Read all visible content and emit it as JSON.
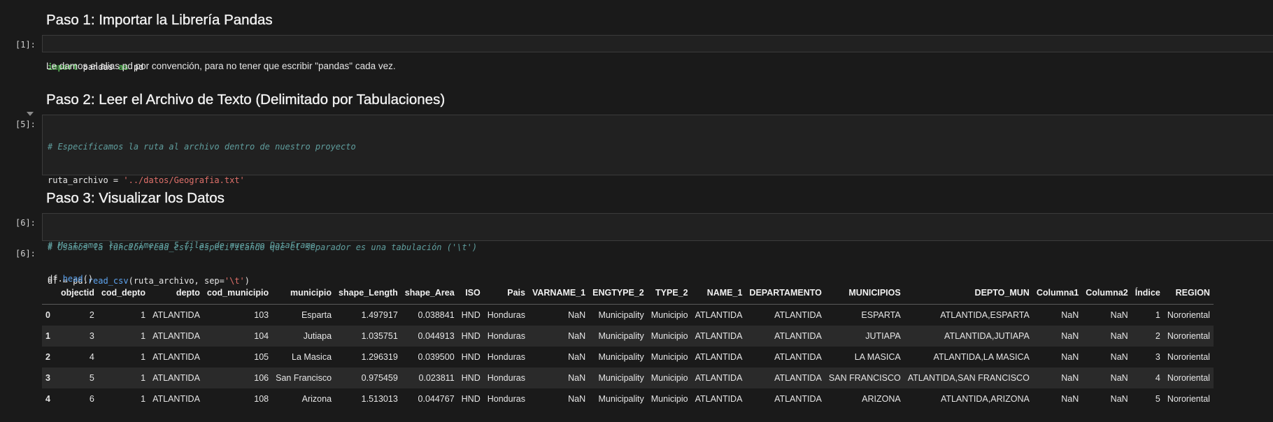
{
  "headings": {
    "h1": "Paso 1: Importar la Librería Pandas",
    "h2": "Paso 2: Leer el Archivo de Texto (Delimitado por Tabulaciones)",
    "h3": "Paso 3: Visualizar los Datos"
  },
  "paragraph1": "Le damos el alias pd por convención, para no tener que escribir \"pandas\" cada vez.",
  "prompts": {
    "cell1": "[1]:",
    "cell2": "[5]:",
    "cell3": "[6]:",
    "out3": "[6]:"
  },
  "code": {
    "c1_import": "import",
    "c1_mid": " pandas ",
    "c1_as": "as",
    "c1_end": " pd",
    "c2_comment1": "# Especificamos la ruta al archivo dentro de nuestro proyecto",
    "c2_var": "ruta_archivo = ",
    "c2_path": "'../datos/Geografia.txt'",
    "c2_comment2": "# Usamos la función read_csv, especificando que el separador es una tabulación ('\\t')",
    "c2_df": "df = pd.",
    "c2_fn": "read_csv",
    "c2_args": "(ruta_archivo, sep=",
    "c2_sep": "'\\t'",
    "c2_close": ")",
    "c3_comment": "# Mostramos las primeras 5 filas de nuestro DataFrame",
    "c3_df": "df.",
    "c3_fn": "head",
    "c3_close": "()"
  },
  "table": {
    "columns": [
      "",
      "objectid",
      "cod_depto",
      "depto",
      "cod_municipio",
      "municipio",
      "shape_Length",
      "shape_Area",
      "ISO",
      "Pais",
      "VARNAME_1",
      "ENGTYPE_2",
      "TYPE_2",
      "NAME_1",
      "DEPARTAMENTO",
      "MUNICIPIOS",
      "DEPTO_MUN",
      "Columna1",
      "Columna2",
      "Índice",
      "REGION"
    ],
    "rows": [
      [
        "0",
        "2",
        "1",
        "ATLANTIDA",
        "103",
        "Esparta",
        "1.497917",
        "0.038841",
        "HND",
        "Honduras",
        "NaN",
        "Municipality",
        "Municipio",
        "ATLANTIDA",
        "ATLANTIDA",
        "ESPARTA",
        "ATLANTIDA,ESPARTA",
        "NaN",
        "NaN",
        "1",
        "Nororiental"
      ],
      [
        "1",
        "3",
        "1",
        "ATLANTIDA",
        "104",
        "Jutiapa",
        "1.035751",
        "0.044913",
        "HND",
        "Honduras",
        "NaN",
        "Municipality",
        "Municipio",
        "ATLANTIDA",
        "ATLANTIDA",
        "JUTIAPA",
        "ATLANTIDA,JUTIAPA",
        "NaN",
        "NaN",
        "2",
        "Nororiental"
      ],
      [
        "2",
        "4",
        "1",
        "ATLANTIDA",
        "105",
        "La Masica",
        "1.296319",
        "0.039500",
        "HND",
        "Honduras",
        "NaN",
        "Municipality",
        "Municipio",
        "ATLANTIDA",
        "ATLANTIDA",
        "LA MASICA",
        "ATLANTIDA,LA MASICA",
        "NaN",
        "NaN",
        "3",
        "Nororiental"
      ],
      [
        "3",
        "5",
        "1",
        "ATLANTIDA",
        "106",
        "San Francisco",
        "0.975459",
        "0.023811",
        "HND",
        "Honduras",
        "NaN",
        "Municipality",
        "Municipio",
        "ATLANTIDA",
        "ATLANTIDA",
        "SAN FRANCISCO",
        "ATLANTIDA,SAN FRANCISCO",
        "NaN",
        "NaN",
        "4",
        "Nororiental"
      ],
      [
        "4",
        "6",
        "1",
        "ATLANTIDA",
        "108",
        "Arizona",
        "1.513013",
        "0.044767",
        "HND",
        "Honduras",
        "NaN",
        "Municipality",
        "Municipio",
        "ATLANTIDA",
        "ATLANTIDA",
        "ARIZONA",
        "ATLANTIDA,ARIZONA",
        "NaN",
        "NaN",
        "5",
        "Nororiental"
      ]
    ]
  }
}
